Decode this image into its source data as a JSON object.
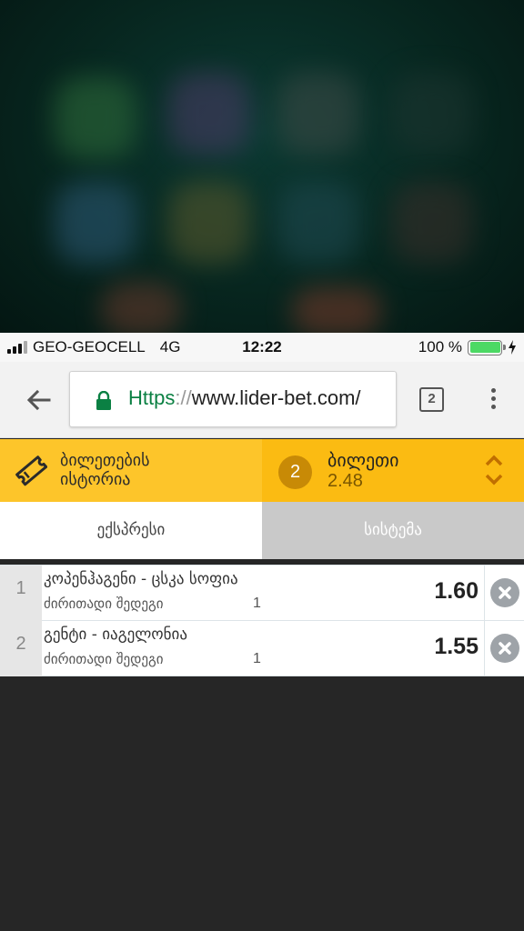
{
  "status_bar": {
    "carrier": "GEO-GEOCELL",
    "network": "4G",
    "time": "12:22",
    "battery": "100 %"
  },
  "browser": {
    "url_scheme": "https",
    "url_separator": "://",
    "url_host": "www.lider-bet.com/",
    "tab_count": "2",
    "back_icon": "arrow-left-icon",
    "lock_icon": "lock-icon",
    "menu_icon": "more-vertical-icon"
  },
  "ticket_bar": {
    "history_line1": "ბილეთების",
    "history_line2": "ისტორია",
    "ticket_count": "2",
    "ticket_label": "ბილეთი",
    "total_odds": "2.48"
  },
  "bet_type_tabs": {
    "express": "ექსპრესი",
    "system": "სისტემა"
  },
  "bets": [
    {
      "index": "1",
      "event": "კოპენჰაგენი - ცსკა სოფია",
      "market": "ძირითადი შედეგი",
      "outcome": "1",
      "odds": "1.60"
    },
    {
      "index": "2",
      "event": "გენტი - იაგელონია",
      "market": "ძირითადი შედეგი",
      "outcome": "1",
      "odds": "1.55"
    }
  ],
  "colors": {
    "ticket_left": "#fdc52a",
    "ticket_right": "#fbbb12",
    "badge": "#c88a06",
    "secure_scheme": "#0b8043",
    "battery": "#4cd964"
  }
}
